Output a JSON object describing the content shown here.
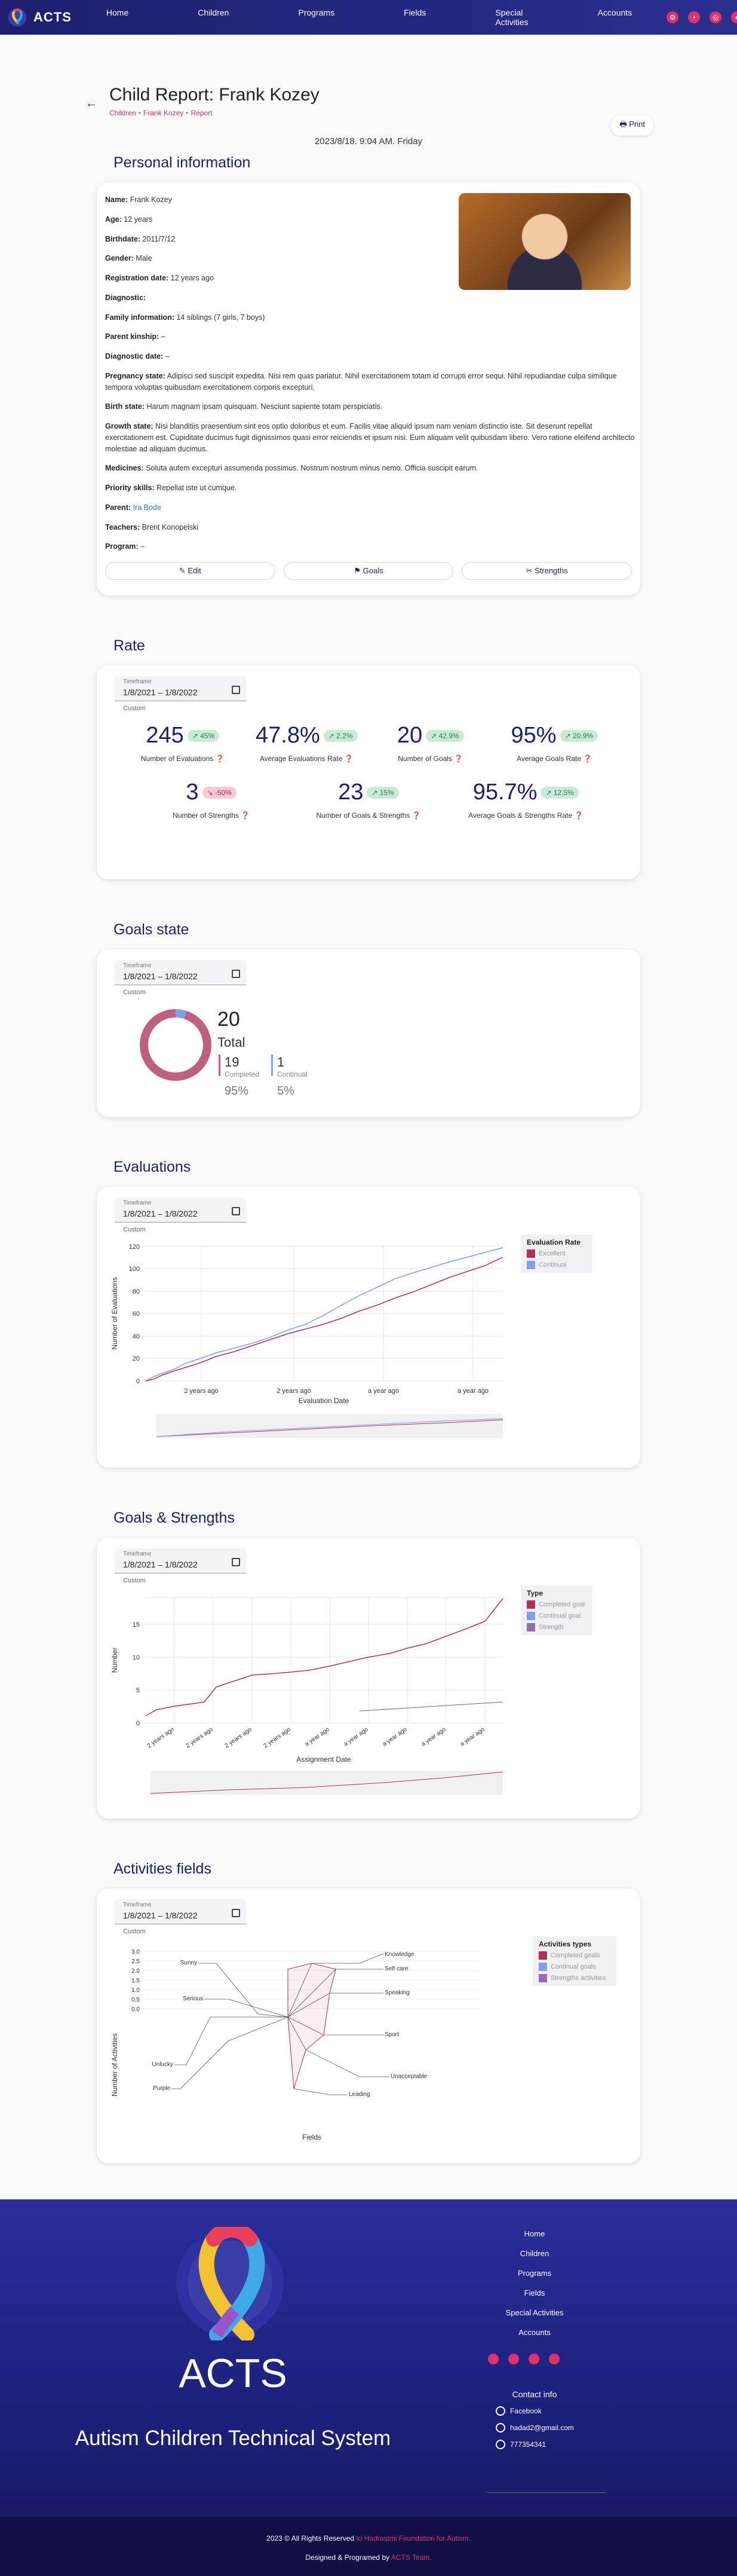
{
  "nav": {
    "brand": "ACTS",
    "links": [
      "Home",
      "Children",
      "Programs",
      "Fields",
      "Special Activities",
      "Accounts"
    ],
    "icons": [
      "gear-icon",
      "bell-icon",
      "globe-icon",
      "user-icon"
    ]
  },
  "header": {
    "title": "Child Report: Frank Kozey",
    "breadcrumb": [
      "Children",
      "Frank Kozey",
      "Report"
    ],
    "print_label": "Print",
    "date": "2023/8/18. 9:04 AM. Friday"
  },
  "personal": {
    "section_title": "Personal information",
    "fields": [
      {
        "label": "Name:",
        "value": "Frank Kozey"
      },
      {
        "label": "Age:",
        "value": "12 years"
      },
      {
        "label": "Birthdate:",
        "value": "2011/7/12"
      },
      {
        "label": "Gender:",
        "value": "Male"
      },
      {
        "label": "Registration date:",
        "value": "12 years ago"
      },
      {
        "label": "Diagnostic:",
        "value": ""
      },
      {
        "label": "Family information:",
        "value": " 14 siblings (7 girls, 7 boys)"
      },
      {
        "label": "Parent kinship:",
        "value": " –"
      },
      {
        "label": "Diagnostic date:",
        "value": " –"
      },
      {
        "label": "Pregnancy state:",
        "value": "Adipisci sed suscipit expedita. Nisi rem quas pariatur. Nihil exercitationem totam id corrupti error sequi. Nihil repudiandae culpa similique tempora voluptas quibusdam exercitationem corporis excepturi."
      },
      {
        "label": "Birth state:",
        "value": "Harum magnam ipsam quisquam. Nesciunt sapiente totam perspiciatis."
      },
      {
        "label": "Growth state:",
        "value": "Nisi blanditiis praesentium sint eos optio doloribus et eum. Facilis vitae aliquid ipsum nam veniam distinctio iste. Sit deserunt repellat exercitationem est. Cupiditate ducimus fugit dignissimos quasi error reiciendis et ipsum nisi. Eum aliquam velit quibusdam libero. Vero ratione eleifend architecto molestiae ad aliquam ducimus."
      },
      {
        "label": "Medicines:",
        "value": "Soluta autem excepturi assumenda possimus. Nostrum nostrum minus nemo. Officia suscipit earum."
      },
      {
        "label": "Priority skills:",
        "value": "Repellat iste ut cumque."
      },
      {
        "label": "Parent:",
        "value": " Ira Bode",
        "link": true
      },
      {
        "label": "Teachers:",
        "value": "Brent Konopelski"
      },
      {
        "label": "Program:",
        "value": " –"
      }
    ],
    "actions": [
      "Edit",
      "Goals",
      "Strengths"
    ]
  },
  "timeframe": {
    "label": "Timeframe",
    "value": "1/8/2021 – 1/8/2022",
    "custom": "Custom"
  },
  "rate": {
    "section_title": "Rate",
    "stats_row1": [
      {
        "value": "245",
        "delta": "45%",
        "dir": "up",
        "caption": "Number of Evaluations"
      },
      {
        "value": "47.8%",
        "delta": "2.2%",
        "dir": "up",
        "caption": "Average Evaluations Rate"
      },
      {
        "value": "20",
        "delta": "42.9%",
        "dir": "up",
        "caption": "Number of Goals"
      },
      {
        "value": "95%",
        "delta": "20.9%",
        "dir": "up",
        "caption": "Average Goals Rate"
      }
    ],
    "stats_row2": [
      {
        "value": "3",
        "delta": "-50%",
        "dir": "down",
        "caption": "Number of Strengths"
      },
      {
        "value": "23",
        "delta": "15%",
        "dir": "up",
        "caption": "Number of Goals & Strengths"
      },
      {
        "value": "95.7%",
        "delta": "12.5%",
        "dir": "up",
        "caption": "Average Goals & Strengths Rate"
      }
    ]
  },
  "goals_state": {
    "section_title": "Goals state",
    "total": "20",
    "total_label": "Total",
    "completed": "19",
    "completed_label": "Completed",
    "completed_pct": "95%",
    "continual": "1",
    "continual_label": "Continual",
    "continual_pct": "5%"
  },
  "evaluations": {
    "section_title": "Evaluations",
    "legend_title": "Evaluation Rate",
    "legend": [
      "Excellent",
      "Continual"
    ],
    "xlabel": "Evaluation Date",
    "ylabel": "Number of Evaluations",
    "yticks": [
      "120",
      "100",
      "80",
      "60",
      "40",
      "20",
      "0"
    ],
    "xticks": [
      "2 years ago",
      "2 years ago",
      "a year ago",
      "a year ago"
    ]
  },
  "goals_strengths": {
    "section_title": "Goals & Strengths",
    "legend_title": "Type",
    "legend": [
      "Completed goal",
      "Continual goal",
      "Strength"
    ],
    "xlabel": "Assignment Date",
    "ylabel": "Number",
    "yticks": [
      "15",
      "10",
      "5",
      "0"
    ],
    "xticks": [
      "2 years ago",
      "2 years ago",
      "2 years ago",
      "2 years ago",
      "a year ago",
      "a year ago",
      "a year ago",
      "a year ago",
      "a year ago"
    ]
  },
  "activities": {
    "section_title": "Activities fields",
    "legend_title": "Activities types",
    "legend": [
      "Completed goals",
      "Continual goals",
      "Strengths activities"
    ],
    "xlabel": "Fields",
    "ylabel": "Number of Activities",
    "yticks": [
      "3.0",
      "2.5",
      "2.0",
      "1.5",
      "1.0",
      "0.5",
      "0.0"
    ],
    "fields_left": [
      "Sunny",
      "Serious",
      "Unlucky",
      "Purple"
    ],
    "fields_right": [
      "Knowledge",
      "Self care",
      "Speaking",
      "Sport",
      "Unacceptable",
      "Leading"
    ]
  },
  "footer": {
    "brand": "ACTS",
    "subtitle": "Autism Children Technical System",
    "links": [
      "Home",
      "Children",
      "Programs",
      "Fields",
      "Special Activities",
      "Accounts"
    ],
    "contact_title": "Contact info",
    "contacts": [
      "Facebook",
      "hadad2@gmail.com",
      "777354341"
    ],
    "copyright_pre": "2023 ©  All Rights Reserved ",
    "copyright_org": "to Hadrastmi Foundation for Autism.",
    "credit_pre": "Designed & Programed by ",
    "credit_team": "ACTS Team."
  }
}
